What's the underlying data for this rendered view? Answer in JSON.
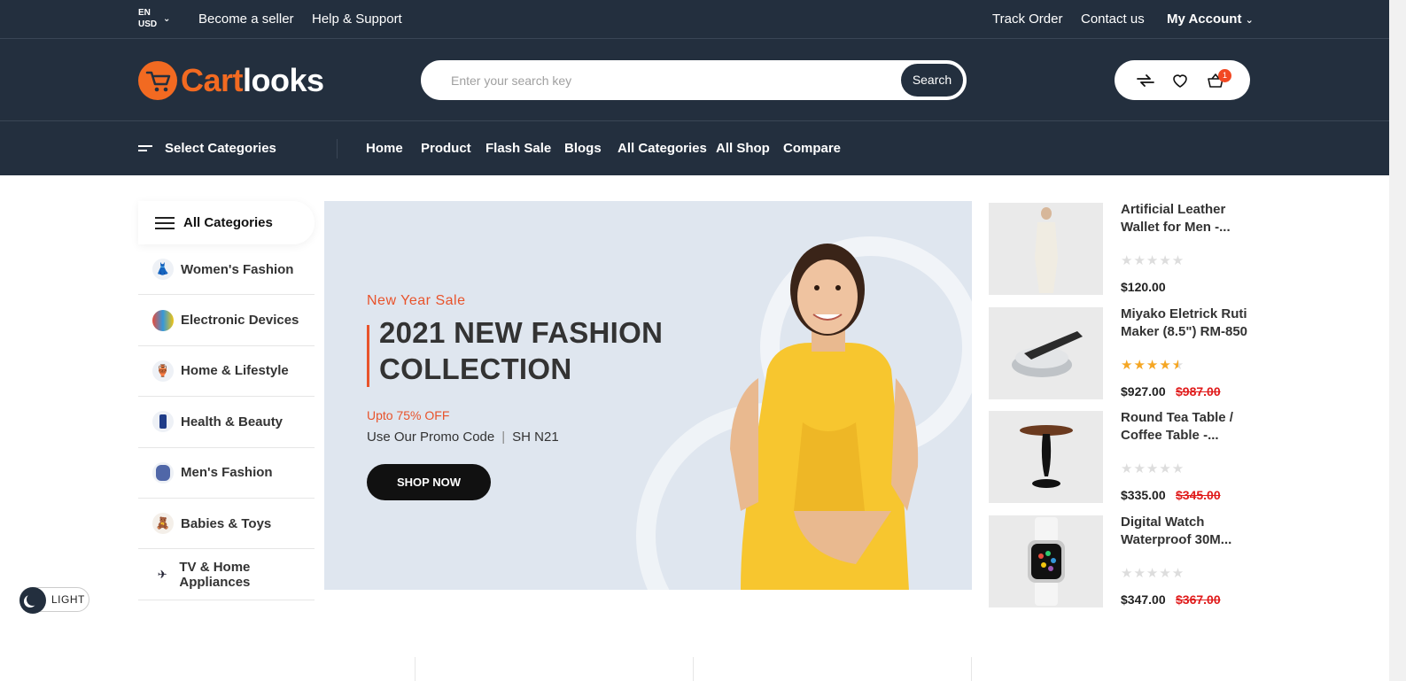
{
  "topbar": {
    "lang": "EN",
    "currency": "USD",
    "links_left": [
      "Become a seller",
      "Help & Support"
    ],
    "links_right": [
      "Track Order",
      "Contact us"
    ],
    "account": "My Account"
  },
  "header": {
    "logo_part1": "Cart",
    "logo_part2": "looks",
    "search_placeholder": "Enter your search key",
    "search_button": "Search",
    "cart_count": "1",
    "icon_names": [
      "compare-icon",
      "wishlist-heart-icon",
      "cart-icon"
    ]
  },
  "nav": {
    "select_categories": "Select Categories",
    "links": [
      "Home",
      "Product",
      "Flash Sale",
      "Blogs",
      "All Categories",
      "All Shop",
      "Compare"
    ]
  },
  "sidebar": {
    "title": "All Categories",
    "items": [
      {
        "label": "Women's Fashion",
        "icon": "dress-icon"
      },
      {
        "label": "Electronic Devices",
        "icon": "device-icon"
      },
      {
        "label": "Home & Lifestyle",
        "icon": "home-icon"
      },
      {
        "label": "Health & Beauty",
        "icon": "beauty-icon"
      },
      {
        "label": "Men's Fashion",
        "icon": "shirt-icon"
      },
      {
        "label": "Babies & Toys",
        "icon": "toy-icon"
      },
      {
        "label": "TV & Home Appliances",
        "icon": "appliance-icon"
      }
    ]
  },
  "banner": {
    "subtitle": "New Year Sale",
    "headline_line1": "2021 NEW FASHION",
    "headline_line2": "COLLECTION",
    "offer": "Upto 75% OFF",
    "promo_label": "Use Our Promo Code",
    "promo_code": "SH N21",
    "button": "SHOP NOW",
    "accent_color": "#e8532b"
  },
  "products": [
    {
      "name": "Artificial Leather Wallet for Men -...",
      "rating": 0,
      "price": "$120.00",
      "old_price": ""
    },
    {
      "name": "Miyako Eletrick Ruti Maker (8.5\") RM-850",
      "rating": 4.5,
      "price": "$927.00",
      "old_price": "$987.00"
    },
    {
      "name": "Round Tea Table / Coffee Table -...",
      "rating": 0,
      "price": "$335.00",
      "old_price": "$345.00"
    },
    {
      "name": "Digital Watch Waterproof 30M...",
      "rating": 0,
      "price": "$347.00",
      "old_price": "$367.00"
    }
  ],
  "theme_toggle": {
    "label": "LIGHT"
  },
  "colors": {
    "header_bg": "#232f3e",
    "brand_orange": "#f26a21",
    "star": "#f5a623",
    "sale_red": "#e01b1b"
  }
}
